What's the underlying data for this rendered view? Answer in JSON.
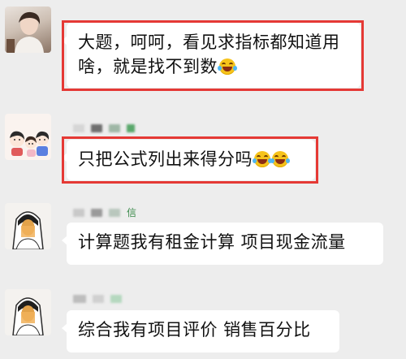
{
  "messages": [
    {
      "id": "m1",
      "avatar": "photo-avatar",
      "lines": [
        "大题，呵呵，看见求指标都知道用",
        "啥，就是找不到数"
      ],
      "emoji": [
        "laugh-cry-emoji"
      ],
      "highlighted": true
    },
    {
      "id": "m2",
      "avatar": "cartoon-family-avatar",
      "lines": [
        "只把公式列出来得分吗"
      ],
      "emoji": [
        "laugh-cry-emoji",
        "laugh-cry-emoji"
      ],
      "highlighted": true
    },
    {
      "id": "m3",
      "avatar": "bride-avatar",
      "sender_visible_fragment": "信",
      "lines": [
        "计算题我有租金计算  项目现金流量"
      ],
      "highlighted": false
    },
    {
      "id": "m4",
      "avatar": "bride-avatar",
      "lines": [
        "综合我有项目评价  销售百分比"
      ],
      "highlighted": false
    }
  ],
  "colors": {
    "background": "#ededed",
    "bubble": "#ffffff",
    "highlight_border": "#e53935",
    "sender_name": "#3a8a4a"
  }
}
